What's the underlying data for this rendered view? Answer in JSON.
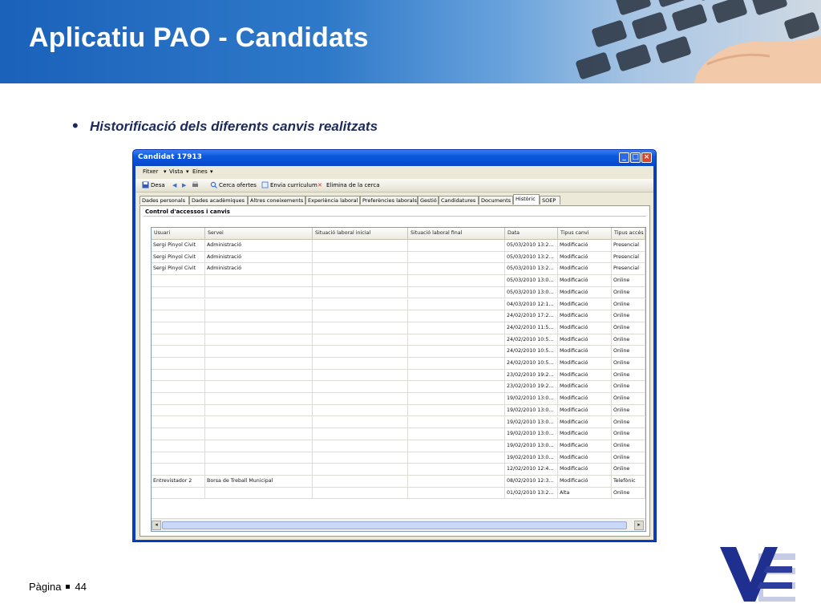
{
  "slide": {
    "title": "Aplicatiu PAO - Candidats",
    "bullet": "Historificació dels diferents canvis realitzats",
    "footer_label": "Pàgina",
    "page_number": "44"
  },
  "window": {
    "title": "Candidat 17913",
    "menu": [
      "Fitxer",
      "Vista",
      "Eines"
    ],
    "toolbar": {
      "save": "Desa",
      "search_offers": "Cerca ofertes",
      "send_cv": "Envia currículum",
      "remove_search": "Elimina de la cerca"
    },
    "tabs": [
      "Dades personals",
      "Dades acadèmiques",
      "Altres coneixements",
      "Experiència laboral",
      "Preferències laborals",
      "Gestió",
      "Candidatures",
      "Documents",
      "Històric",
      "SOEP"
    ],
    "active_tab": "Històric",
    "group_title": "Control d'accessos i canvis",
    "columns": [
      "Usuari",
      "Servei",
      "Situació laboral inicial",
      "Situació laboral final",
      "Data",
      "Tipus canvi",
      "Tipus accés"
    ],
    "rows": [
      [
        "Sergi Pinyol Civit",
        "Administració",
        "",
        "",
        "05/03/2010 13:2...",
        "Modificació",
        "Presencial"
      ],
      [
        "Sergi Pinyol Civit",
        "Administració",
        "",
        "",
        "05/03/2010 13:2...",
        "Modificació",
        "Presencial"
      ],
      [
        "Sergi Pinyol Civit",
        "Administració",
        "",
        "",
        "05/03/2010 13:2...",
        "Modificació",
        "Presencial"
      ],
      [
        "",
        "",
        "",
        "",
        "05/03/2010 13:0...",
        "Modificació",
        "Online"
      ],
      [
        "",
        "",
        "",
        "",
        "05/03/2010 13:0...",
        "Modificació",
        "Online"
      ],
      [
        "",
        "",
        "",
        "",
        "04/03/2010 12:1...",
        "Modificació",
        "Online"
      ],
      [
        "",
        "",
        "",
        "",
        "24/02/2010 17:2...",
        "Modificació",
        "Online"
      ],
      [
        "",
        "",
        "",
        "",
        "24/02/2010 11:5...",
        "Modificació",
        "Online"
      ],
      [
        "",
        "",
        "",
        "",
        "24/02/2010 10:5...",
        "Modificació",
        "Online"
      ],
      [
        "",
        "",
        "",
        "",
        "24/02/2010 10:5...",
        "Modificació",
        "Online"
      ],
      [
        "",
        "",
        "",
        "",
        "24/02/2010 10:5...",
        "Modificació",
        "Online"
      ],
      [
        "",
        "",
        "",
        "",
        "23/02/2010 19:2...",
        "Modificació",
        "Online"
      ],
      [
        "",
        "",
        "",
        "",
        "23/02/2010 19:2...",
        "Modificació",
        "Online"
      ],
      [
        "",
        "",
        "",
        "",
        "19/02/2010 13:0...",
        "Modificació",
        "Online"
      ],
      [
        "",
        "",
        "",
        "",
        "19/02/2010 13:0...",
        "Modificació",
        "Online"
      ],
      [
        "",
        "",
        "",
        "",
        "19/02/2010 13:0...",
        "Modificació",
        "Online"
      ],
      [
        "",
        "",
        "",
        "",
        "19/02/2010 13:0...",
        "Modificació",
        "Online"
      ],
      [
        "",
        "",
        "",
        "",
        "19/02/2010 13:0...",
        "Modificació",
        "Online"
      ],
      [
        "",
        "",
        "",
        "",
        "19/02/2010 13:0...",
        "Modificació",
        "Online"
      ],
      [
        "",
        "",
        "",
        "",
        "12/02/2010 12:4...",
        "Modificació",
        "Online"
      ],
      [
        "Entrevistador 2",
        "Borsa de Treball Municipal",
        "",
        "",
        "08/02/2010 12:3...",
        "Modificació",
        "Telefònic"
      ],
      [
        "",
        "",
        "",
        "",
        "01/02/2010 13:2...",
        "Alta",
        "Online"
      ]
    ]
  },
  "colors": {
    "banner_blue": "#1a62ba",
    "text_navy": "#1c2a5a",
    "xp_title_blue": "#0a58e0"
  }
}
